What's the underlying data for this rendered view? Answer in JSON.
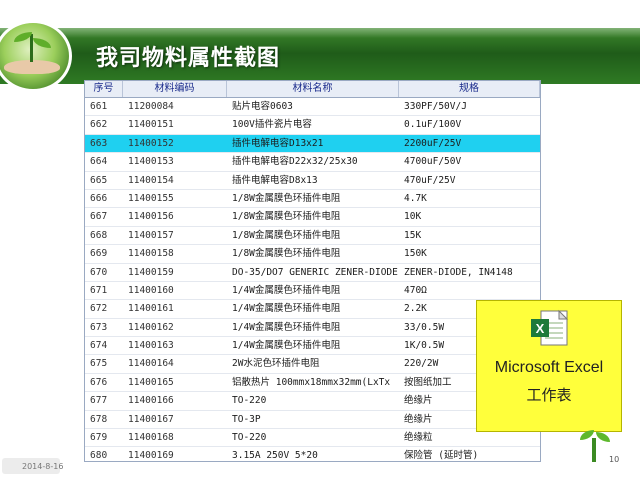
{
  "slide": {
    "title": "我司物料属性截图",
    "footer_date": "2014-8-16",
    "page_number": "10"
  },
  "table": {
    "headers": [
      "序号",
      "材料编码",
      "材料名称",
      "规格"
    ],
    "selected_row": 2,
    "selected_color": "#1fd0f0",
    "rows": [
      [
        "661",
        "11200084",
        "贴片电容0603",
        "330PF/50V/J"
      ],
      [
        "662",
        "11400151",
        " 100V插件瓷片电容",
        "0.1uF/100V"
      ],
      [
        "663",
        "11400152",
        " 插件电解电容D13x21",
        "2200uF/25V"
      ],
      [
        "664",
        "11400153",
        "  插件电解电容D22x32/25x30",
        "4700uF/50V"
      ],
      [
        "665",
        "11400154",
        "  插件电解电容D8x13",
        "470uF/25V"
      ],
      [
        "666",
        "11400155",
        "1/8W金属膜色环插件电阻",
        "4.7K"
      ],
      [
        "667",
        "11400156",
        " 1/8W金属膜色环插件电阻",
        "10K"
      ],
      [
        "668",
        "11400157",
        " 1/8W金属膜色环插件电阻",
        "15K"
      ],
      [
        "669",
        "11400158",
        " 1/8W金属膜色环插件电阻",
        "150K"
      ],
      [
        "670",
        "11400159",
        "DO-35/DO7  GENERIC ZENER-DIODE",
        "ZENER-DIODE, IN4148"
      ],
      [
        "671",
        "11400160",
        "1/4W金属膜色环插件电阻",
        "470Ω"
      ],
      [
        "672",
        "11400161",
        " 1/4W金属膜色环插件电阻",
        "2.2K"
      ],
      [
        "673",
        "11400162",
        " 1/4W金属膜色环插件电阻",
        "33/0.5W"
      ],
      [
        "674",
        "11400163",
        "1/4W金属膜色环插件电阻",
        "1K/0.5W"
      ],
      [
        "675",
        "11400164",
        "  2W水泥色环插件电阻",
        "220/2W"
      ],
      [
        "676",
        "11400165",
        "铝散热片  100mmx18mmx32mm(LxTx",
        "按图纸加工"
      ],
      [
        "677",
        "11400166",
        "TO-220",
        "绝缘片"
      ],
      [
        "678",
        "11400167",
        "TO-3P",
        "绝缘片"
      ],
      [
        "679",
        "11400168",
        "TO-220",
        "绝缘粒"
      ],
      [
        "680",
        "11400169",
        "3.15A 250V  5*20",
        "保险管 (延时管)"
      ]
    ]
  },
  "excel_card": {
    "line1": "Microsoft Excel",
    "line2": "工作表",
    "icon": "excel-icon",
    "background": "#ffff3b"
  },
  "colors": {
    "banner_green": "#1f5c19",
    "header_text": "#1a2b8c"
  }
}
